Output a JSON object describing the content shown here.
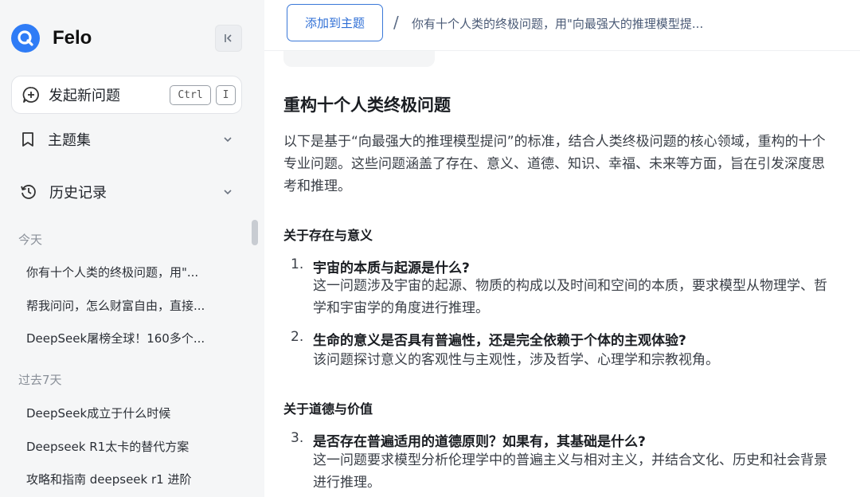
{
  "app": {
    "name": "Felo",
    "brand_color": "#2f7cf6"
  },
  "sidebar": {
    "new_question": {
      "label": "发起新问题",
      "shortcut_ctrl": "Ctrl",
      "shortcut_key": "I"
    },
    "nav": [
      {
        "label": "主题集",
        "icon": "bookmark-icon"
      },
      {
        "label": "历史记录",
        "icon": "history-icon"
      }
    ],
    "sections": {
      "today": "今天",
      "past7": "过去7天"
    },
    "history_today": [
      "你有十个人类的终极问题，用\"...",
      "帮我问问，怎么财富自由，直接...",
      "DeepSeek屠榜全球！160多个..."
    ],
    "history_past7": [
      "DeepSeek成立于什么时候",
      "Deepseek R1太卡的替代方案",
      "攻略和指南 deepseek r1 进阶"
    ]
  },
  "topbar": {
    "add_topic": "添加到主题",
    "separator": "/",
    "title": "你有十个人类的终极问题，用\"向最强大的推理模型提..."
  },
  "content": {
    "heading": "重构十个人类终极问题",
    "intro": "以下是基于“向最强大的推理模型提问”的标准，结合人类终极问题的核心领域，重构的十个专业问题。这些问题涵盖了存在、意义、道德、知识、幸福、未来等方面，旨在引发深度思考和推理。",
    "section1": "关于存在与意义",
    "section2": "关于道德与价值",
    "questions": [
      {
        "num": "1.",
        "title": "宇宙的本质与起源是什么?",
        "desc": "这一问题涉及宇宙的起源、物质的构成以及时间和空间的本质，要求模型从物理学、哲学和宇宙学的角度进行推理。"
      },
      {
        "num": "2.",
        "title": "生命的意义是否具有普遍性，还是完全依赖于个体的主观体验?",
        "desc": "该问题探讨意义的客观性与主观性，涉及哲学、心理学和宗教视角。"
      },
      {
        "num": "3.",
        "title": "是否存在普遍适用的道德原则？如果有，其基础是什么?",
        "desc": "这一问题要求模型分析伦理学中的普遍主义与相对主义，并结合文化、历史和社会背景进行推理。"
      }
    ]
  }
}
